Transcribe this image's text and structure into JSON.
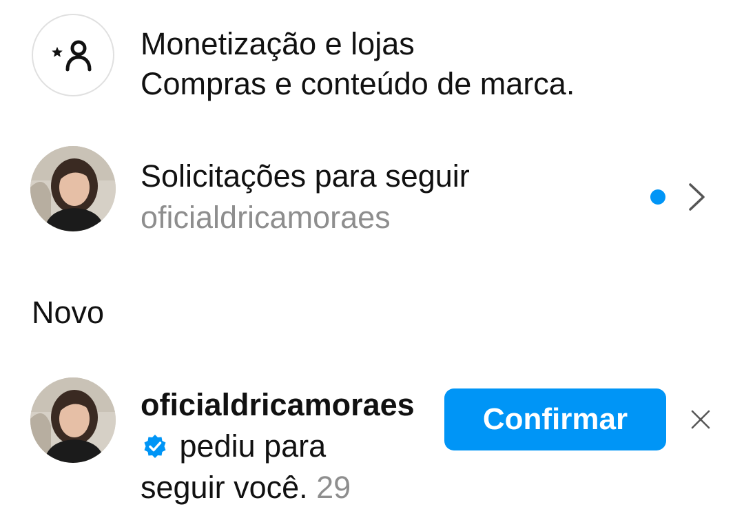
{
  "monetization": {
    "icon": "person-star-icon",
    "title": "Monetização e lojas",
    "subtitle": "Compras e conteúdo de marca."
  },
  "follow_requests": {
    "title": "Solicitações para seguir",
    "username": "oficialdricamoraes",
    "unread": true,
    "accent_color": "#0095f6"
  },
  "sections": {
    "new_label": "Novo"
  },
  "notification": {
    "username": "oficialdricamoraes",
    "verified": true,
    "message": "pediu para seguir você.",
    "time": "29",
    "confirm_label": "Confirmar",
    "dismiss_icon": "close-icon"
  },
  "colors": {
    "primary_blue": "#0095f6",
    "secondary_text": "#8e8e8e"
  }
}
